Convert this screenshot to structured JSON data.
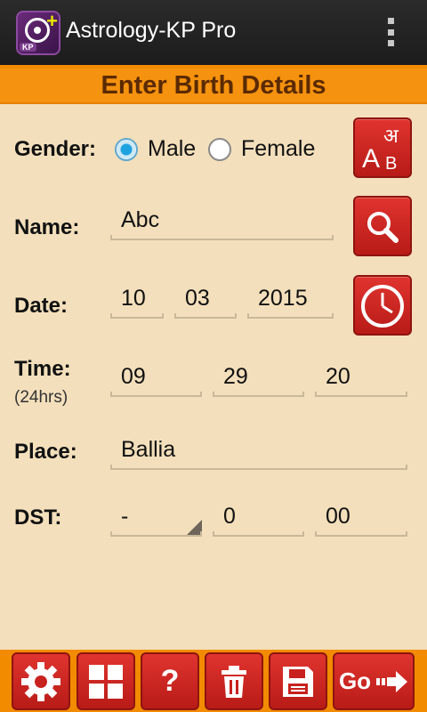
{
  "app": {
    "title": "Astrology-KP Pro",
    "icon_badge": "KP",
    "icon": "kp-app-icon"
  },
  "header": {
    "title": "Enter Birth Details"
  },
  "form": {
    "gender": {
      "label": "Gender:",
      "options": [
        "Male",
        "Female"
      ],
      "selected": "Male"
    },
    "name": {
      "label": "Name:",
      "value": "Abc"
    },
    "date": {
      "label": "Date:",
      "day": "10",
      "month": "03",
      "year": "2015"
    },
    "time": {
      "label": "Time:",
      "sublabel": "(24hrs)",
      "hour": "09",
      "minute": "29",
      "second": "20"
    },
    "place": {
      "label": "Place:",
      "value": "Ballia"
    },
    "dst": {
      "label": "DST:",
      "sign": "-",
      "hours": "0",
      "minutes": "00"
    }
  },
  "side_buttons": {
    "language": {
      "icon": "language-toggle-icon",
      "hindi_glyph": "अ",
      "latin_a": "A",
      "latin_b": "B"
    },
    "search": {
      "icon": "search-icon"
    },
    "clock": {
      "icon": "clock-icon"
    }
  },
  "toolbar": {
    "settings": {
      "icon": "gear-icon"
    },
    "grid": {
      "icon": "grid-icon"
    },
    "help": {
      "icon": "help-icon",
      "glyph": "?"
    },
    "delete": {
      "icon": "trash-icon"
    },
    "save": {
      "icon": "save-icon"
    },
    "go": {
      "label": "Go",
      "icon": "arrow-right-icon"
    }
  },
  "colors": {
    "background": "#f3dfbb",
    "accent_orange": "#f28b00",
    "button_red": "#d42a25",
    "radio_selected": "#1fa2e0",
    "header_text": "#5b2a00"
  }
}
